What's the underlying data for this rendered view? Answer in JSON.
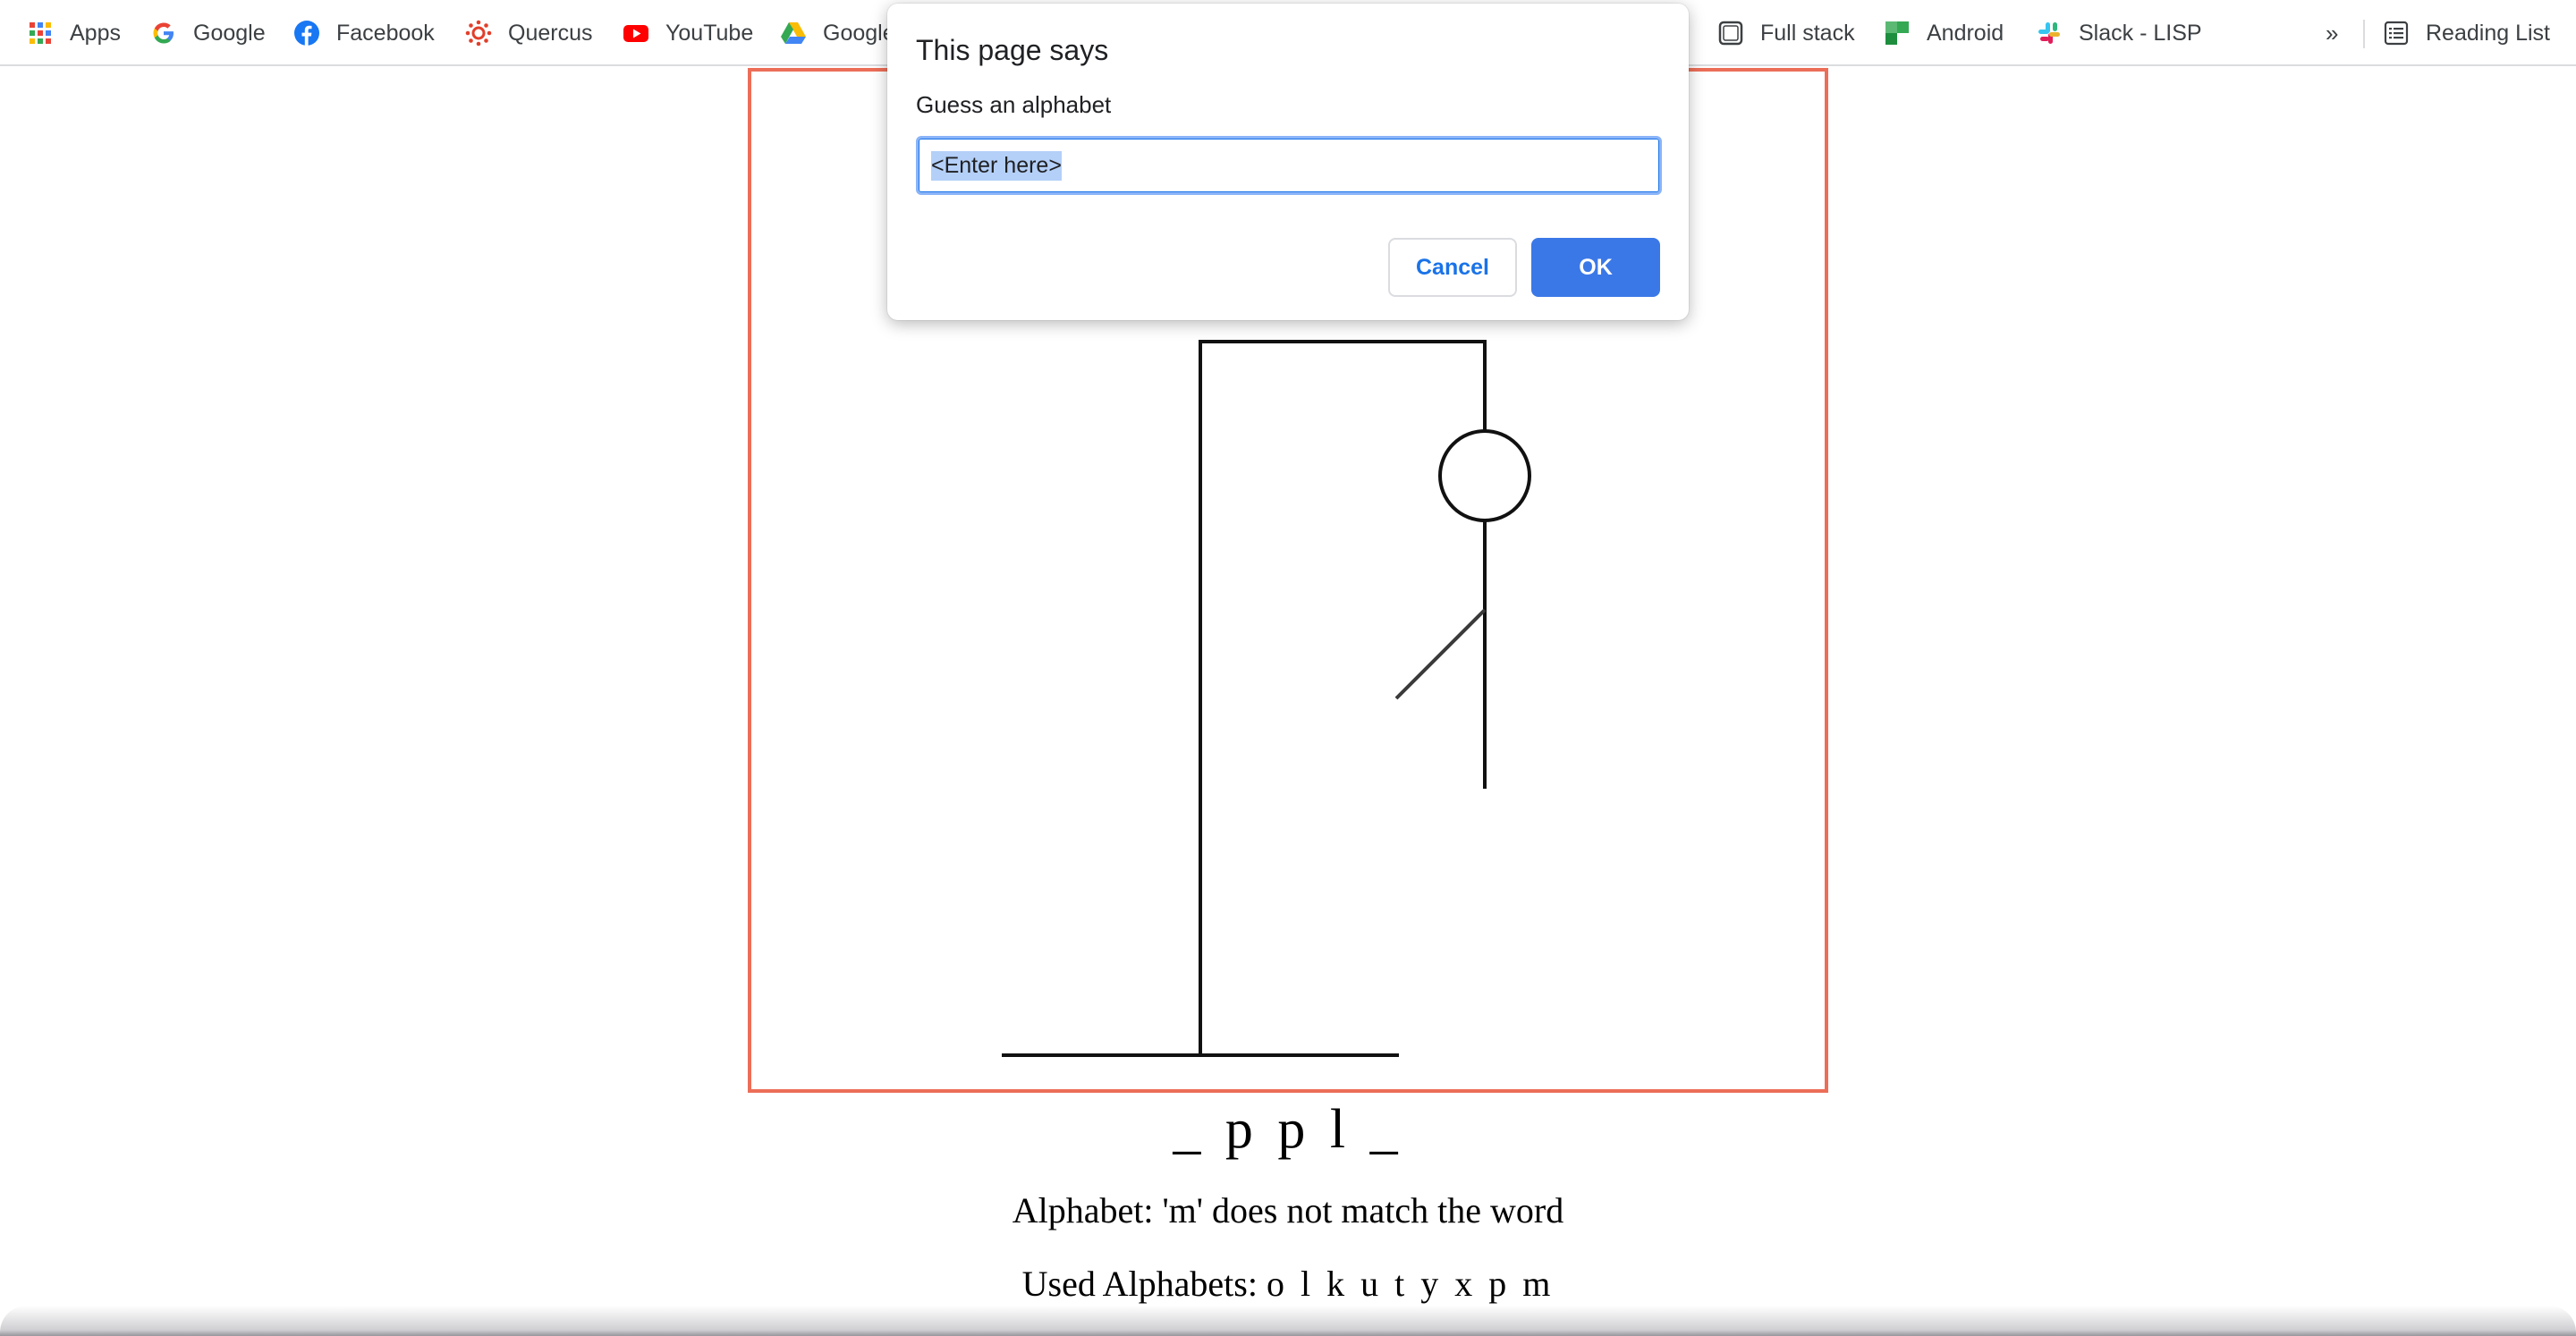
{
  "bookmarks": {
    "items": [
      {
        "label": "Apps",
        "icon": "apps-grid-icon"
      },
      {
        "label": "Google",
        "icon": "google-icon"
      },
      {
        "label": "Facebook",
        "icon": "facebook-icon"
      },
      {
        "label": "Quercus",
        "icon": "quercus-icon"
      },
      {
        "label": "YouTube",
        "icon": "youtube-icon"
      },
      {
        "label": "Google",
        "icon": "google-drive-icon"
      },
      {
        "label": "Full stack",
        "icon": "folder-outline-icon"
      },
      {
        "label": "Android",
        "icon": "android-icon"
      },
      {
        "label": "Slack - LISP",
        "icon": "slack-icon"
      }
    ],
    "more": "»",
    "reading_list": "Reading List"
  },
  "dialog": {
    "title": "This page says",
    "message": "Guess an alphabet",
    "input_value": "<Enter here>",
    "cancel_label": "Cancel",
    "ok_label": "OK"
  },
  "game": {
    "word": "_ p p l _",
    "status": "Alphabet: 'm' does not match the word",
    "used_label": "Used Alphabets:",
    "used_letters": "o l k u t y x p m",
    "hangman_parts_shown": [
      "head",
      "body",
      "left-arm"
    ]
  },
  "colors": {
    "canvas_border": "#ec6e58",
    "ok_button": "#3b78e7",
    "cancel_text": "#1a73e8",
    "input_focus": "#8ab4f8"
  }
}
